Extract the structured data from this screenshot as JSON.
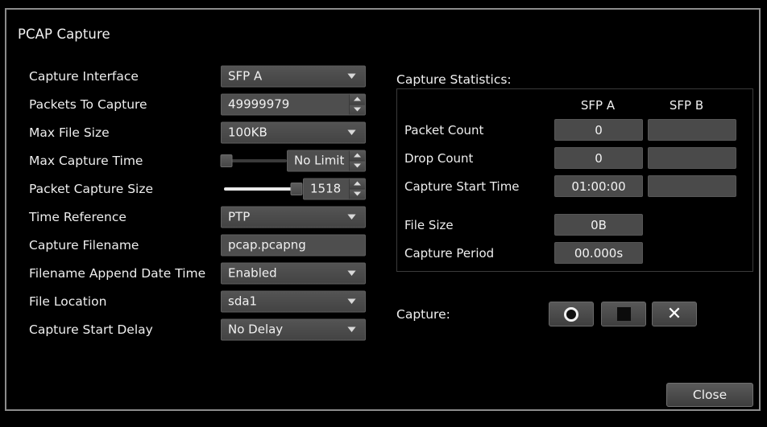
{
  "dialog": {
    "title": "PCAP Capture"
  },
  "form": {
    "rows": [
      {
        "label": "Capture Interface",
        "type": "combo",
        "value": "SFP A"
      },
      {
        "label": "Packets To Capture",
        "type": "spin",
        "value": "49999979"
      },
      {
        "label": "Max File Size",
        "type": "combo",
        "value": "100KB"
      },
      {
        "label": "Max Capture Time",
        "type": "slider_spin",
        "value": "No Limit",
        "slider_percent": 0
      },
      {
        "label": "Packet Capture Size",
        "type": "slider_spin",
        "value": "1518",
        "slider_percent": 100
      },
      {
        "label": "Time Reference",
        "type": "combo",
        "value": "PTP"
      },
      {
        "label": "Capture Filename",
        "type": "text",
        "value": "pcap.pcapng"
      },
      {
        "label": "Filename Append Date Time",
        "type": "combo",
        "value": "Enabled"
      },
      {
        "label": "File Location",
        "type": "combo",
        "value": "sda1"
      },
      {
        "label": "Capture Start Delay",
        "type": "combo",
        "value": "No Delay"
      }
    ]
  },
  "stats": {
    "caption": "Capture Statistics:",
    "columns": [
      "SFP A",
      "SFP B"
    ],
    "rows": [
      {
        "label": "Packet Count",
        "sfp_a": "0",
        "sfp_b": ""
      },
      {
        "label": "Drop Count",
        "sfp_a": "0",
        "sfp_b": ""
      },
      {
        "label": "Capture Start Time",
        "sfp_a": "01:00:00",
        "sfp_b": ""
      },
      {
        "label": "File Size",
        "sfp_a": "0B",
        "sfp_b": null
      },
      {
        "label": "Capture Period",
        "sfp_a": "00.000s",
        "sfp_b": null
      }
    ]
  },
  "capture": {
    "label": "Capture:",
    "buttons": [
      {
        "name": "record",
        "icon": "record-icon"
      },
      {
        "name": "stop",
        "icon": "stop-icon"
      },
      {
        "name": "cancel",
        "icon": "close-x-icon",
        "glyph": "✕"
      }
    ]
  },
  "footer": {
    "close_label": "Close"
  },
  "colors": {
    "background": "#000000",
    "frame_border": "#8c8c8c",
    "control_face": "#4b4b4b",
    "text": "#f0f0f0",
    "slider_fill": "#e9e9e9"
  }
}
